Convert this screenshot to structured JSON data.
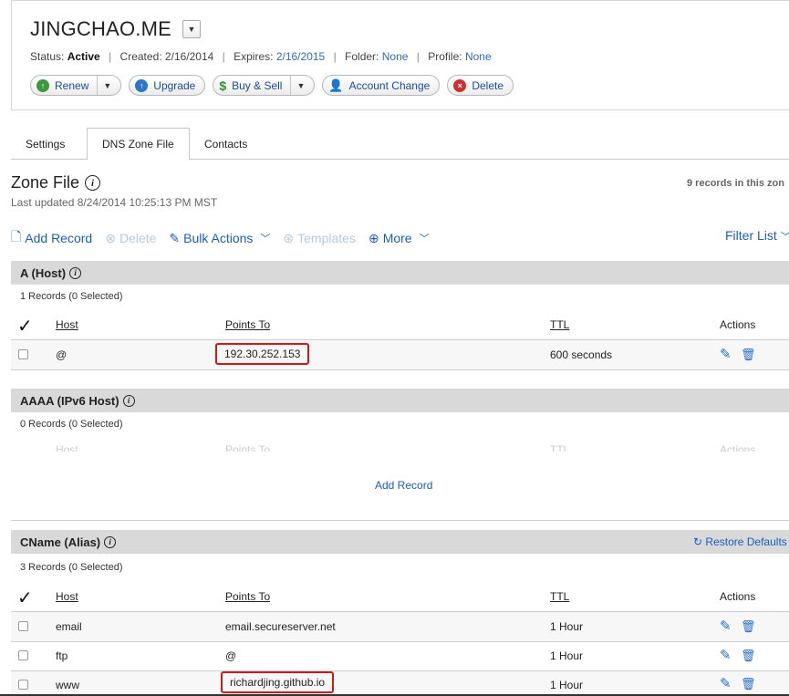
{
  "domain": {
    "name": "JINGCHAO.ME",
    "status_label": "Status:",
    "status_value": "Active",
    "created_label": "Created:",
    "created_value": "2/16/2014",
    "expires_label": "Expires:",
    "expires_value": "2/16/2015",
    "folder_label": "Folder:",
    "folder_value": "None",
    "profile_label": "Profile:",
    "profile_value": "None"
  },
  "actions": {
    "renew": "Renew",
    "upgrade": "Upgrade",
    "buy_sell": "Buy & Sell",
    "account_change": "Account Change",
    "delete": "Delete"
  },
  "tabs": [
    {
      "label": "Settings"
    },
    {
      "label": "DNS Zone File"
    },
    {
      "label": "Contacts"
    }
  ],
  "zone": {
    "title": "Zone File",
    "last_updated": "Last updated 8/24/2014 10:25:13 PM MST",
    "records_count": "9 records in this zon"
  },
  "toolbar": {
    "add_record": "Add Record",
    "delete": "Delete",
    "bulk_actions": "Bulk Actions",
    "templates": "Templates",
    "more": "More",
    "filter_list": "Filter List"
  },
  "columns": {
    "host": "Host",
    "points_to": "Points To",
    "ttl": "TTL",
    "actions": "Actions"
  },
  "sections": {
    "a_host": {
      "title": "A (Host)",
      "summary": "1 Records (0 Selected)",
      "rows": [
        {
          "host": "@",
          "points_to": "192.30.252.153",
          "ttl": "600 seconds"
        }
      ]
    },
    "aaaa": {
      "title": "AAAA (IPv6 Host)",
      "summary": "0 Records (0 Selected)",
      "add_record": "Add Record"
    },
    "cname": {
      "title": "CName (Alias)",
      "summary": "3 Records (0 Selected)",
      "restore_defaults": "Restore Defaults",
      "rows": [
        {
          "host": "email",
          "points_to": "email.secureserver.net",
          "ttl": "1 Hour"
        },
        {
          "host": "ftp",
          "points_to": "@",
          "ttl": "1 Hour"
        },
        {
          "host": "www",
          "points_to": "richardjing.github.io",
          "ttl": "1 Hour"
        }
      ]
    }
  },
  "colors": {
    "link": "#1a5ec0",
    "highlight": "#d01818",
    "section_bg": "#d9d9d9"
  }
}
